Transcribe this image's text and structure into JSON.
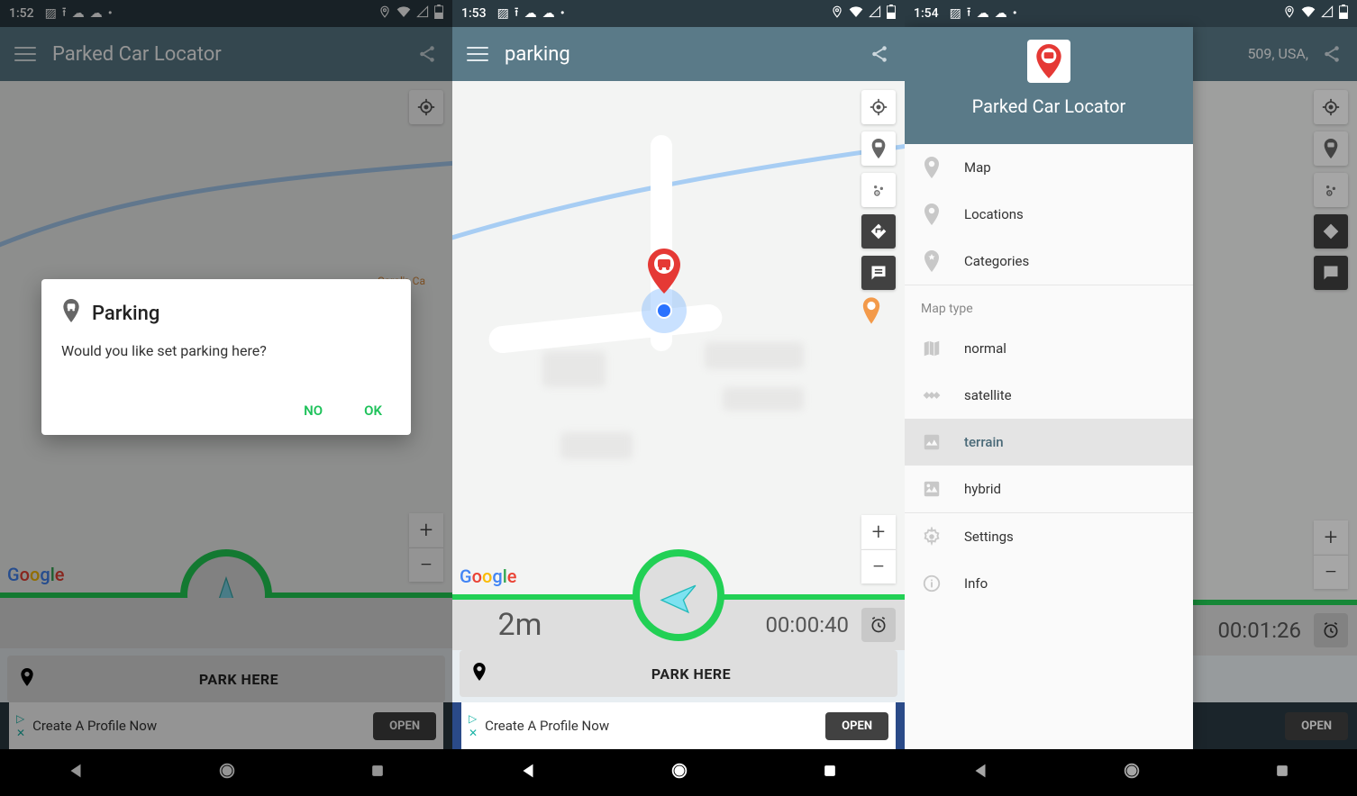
{
  "screen1": {
    "status": {
      "time": "1:52"
    },
    "appbar": {
      "title": "Parked Car Locator"
    },
    "map": {
      "poi_label": "Carol's Ca"
    },
    "park_button": "PARK HERE",
    "ad": {
      "text": "Create A Profile Now",
      "cta": "OPEN"
    },
    "dialog": {
      "title": "Parking",
      "message": "Would you like set parking here?",
      "no": "NO",
      "ok": "OK"
    }
  },
  "screen2": {
    "status": {
      "time": "1:53"
    },
    "appbar": {
      "title": "parking"
    },
    "info": {
      "distance": "2m",
      "timer": "00:00:40"
    },
    "park_button": "PARK HERE",
    "ad": {
      "text": "Create A Profile Now",
      "cta": "OPEN"
    }
  },
  "screen3": {
    "status": {
      "time": "1:54"
    },
    "appbar": {
      "title_addr": "509, USA,"
    },
    "info": {
      "timer": "00:01:26"
    },
    "ad": {
      "cta": "OPEN"
    },
    "drawer": {
      "title": "Parked Car Locator",
      "nav": [
        "Map",
        "Locations",
        "Categories"
      ],
      "section": "Map type",
      "maptypes": [
        "normal",
        "satellite",
        "terrain",
        "hybrid"
      ],
      "selected": "terrain",
      "footer": [
        "Settings",
        "Info"
      ]
    }
  }
}
